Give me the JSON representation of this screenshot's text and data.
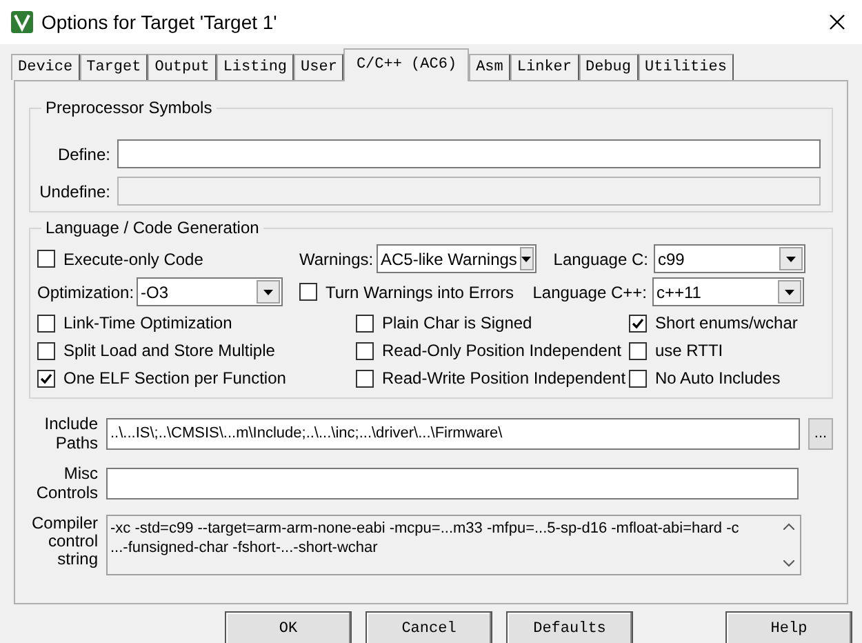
{
  "window": {
    "title": "Options for Target 'Target 1'"
  },
  "tabs": [
    {
      "label": "Device",
      "selected": false
    },
    {
      "label": "Target",
      "selected": false
    },
    {
      "label": "Output",
      "selected": false
    },
    {
      "label": "Listing",
      "selected": false
    },
    {
      "label": "User",
      "selected": false
    },
    {
      "label": "C/C++ (AC6)",
      "selected": true
    },
    {
      "label": "Asm",
      "selected": false
    },
    {
      "label": "Linker",
      "selected": false
    },
    {
      "label": "Debug",
      "selected": false
    },
    {
      "label": "Utilities",
      "selected": false
    }
  ],
  "preprocessor": {
    "title": "Preprocessor Symbols",
    "define": {
      "label": "Define:",
      "disabled": false
    },
    "undefine": {
      "label": "Undefine:",
      "disabled": true
    }
  },
  "language": {
    "title": "Language / Code Generation",
    "execute_only": {
      "label": "Execute-only Code",
      "checked": false
    },
    "warnings": {
      "label": "Warnings:",
      "value": "AC5-like Warnings"
    },
    "language_c": {
      "label": "Language C:",
      "value": "c99"
    },
    "optimization": {
      "label": "Optimization:",
      "value": "-O3"
    },
    "turn_warnings": {
      "label": "Turn Warnings into Errors",
      "checked": false
    },
    "language_cpp": {
      "label": "Language C++:",
      "value": "c++11"
    },
    "checkbox_rows": [
      [
        {
          "label": "Link-Time Optimization",
          "checked": false
        },
        {
          "label": "Plain Char is Signed",
          "checked": false
        },
        {
          "label": "Short enums/wchar",
          "checked": true
        }
      ],
      [
        {
          "label": "Split Load and Store Multiple",
          "checked": false
        },
        {
          "label": "Read-Only Position Independent",
          "checked": false
        },
        {
          "label": "use RTTI",
          "checked": false
        }
      ],
      [
        {
          "label": "One ELF Section per Function",
          "checked": true
        },
        {
          "label": "Read-Write Position Independent",
          "checked": false
        },
        {
          "label": "No Auto Includes",
          "checked": false
        }
      ]
    ]
  },
  "include_paths": {
    "label": "Include Paths",
    "value": "..\\...IS\\;..\\CMSIS\\...m\\Include;..\\...\\inc;...\\driver\\...\\Firmware\\",
    "browse": "..."
  },
  "misc_controls": {
    "label": "Misc Controls"
  },
  "compiler_string": {
    "label": "Compiler control string",
    "lines": [
      "-xc -std=c99 --target=arm-arm-none-eabi -mcpu=...m33 -mfpu=...5-sp-d16 -mfloat-abi=hard -c",
      "...-funsigned-char -fshort-...-short-wchar"
    ]
  },
  "buttons": [
    {
      "label": "OK"
    },
    {
      "label": "Cancel"
    },
    {
      "label": "Defaults"
    },
    {
      "label": "Help"
    }
  ]
}
